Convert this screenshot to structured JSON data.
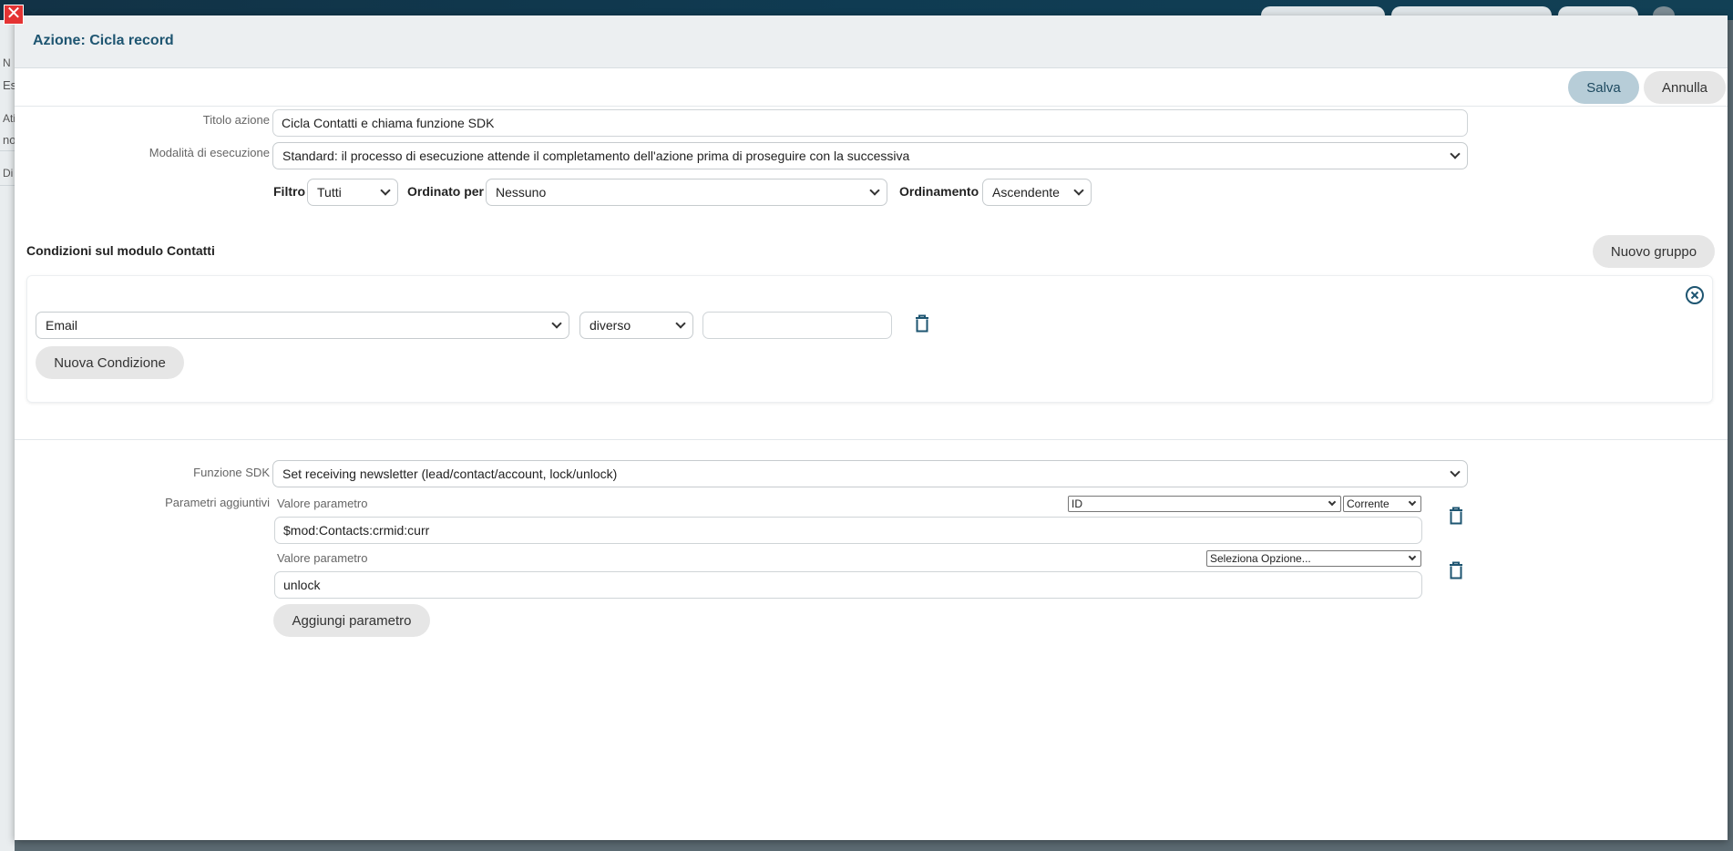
{
  "background": {
    "fragments": [
      "N",
      "Es",
      "Ati",
      "no",
      "Di"
    ]
  },
  "dialog": {
    "title": "Azione: Cicla record",
    "save_label": "Salva",
    "cancel_label": "Annulla"
  },
  "form": {
    "title_label": "Titolo azione",
    "title_value": "Cicla Contatti e chiama funzione SDK",
    "mode_label": "Modalità di esecuzione",
    "mode_value": "Standard: il processo di esecuzione attende il completamento dell'azione prima di proseguire con la successiva",
    "filter_label": "Filtro",
    "filter_value": "Tutti",
    "orderby_label": "Ordinato per",
    "orderby_value": "Nessuno",
    "ordering_label": "Ordinamento",
    "ordering_value": "Ascendente"
  },
  "conditions": {
    "title": "Condizioni sul modulo Contatti",
    "new_group_label": "Nuovo gruppo",
    "field_value": "Email",
    "operator_value": "diverso",
    "condition_value": "",
    "new_condition_label": "Nuova Condizione"
  },
  "sdk": {
    "function_label": "Funzione SDK",
    "function_value": "Set receiving newsletter (lead/contact/account, lock/unlock)",
    "params_label": "Parametri aggiuntivi",
    "params": [
      {
        "label": "Valore parametro",
        "field_select": "ID",
        "scope_select": "Corrente",
        "value": "$mod:Contacts:crmid:curr"
      },
      {
        "label": "Valore parametro",
        "option_select": "Seleziona Opzione...",
        "value": "unlock"
      }
    ],
    "add_param_label": "Aggiungi parametro"
  },
  "colors": {
    "accent": "#1e5571",
    "save_bg": "#b7cdd8",
    "close_red": "#e43333"
  }
}
